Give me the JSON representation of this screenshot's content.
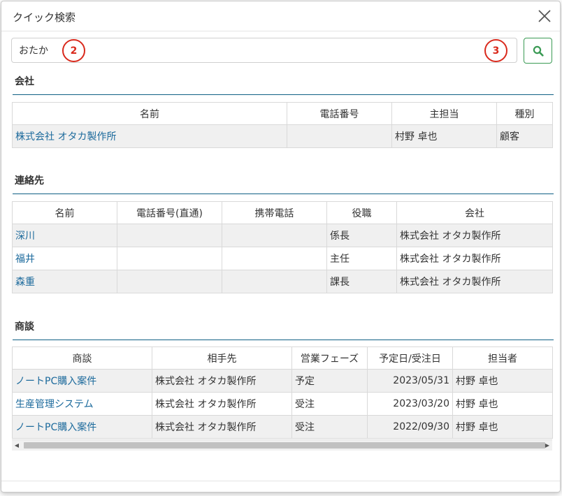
{
  "modal": {
    "title": "クイック検索"
  },
  "search": {
    "value": "おたか",
    "placeholder": "",
    "button_icon": "search-icon",
    "accent": "#3a9a54"
  },
  "markers": [
    "2",
    "3"
  ],
  "sections": {
    "company": {
      "title": "会社",
      "headers": [
        "名前",
        "電話番号",
        "主担当",
        "種別"
      ],
      "rows": [
        [
          "株式会社 オタカ製作所",
          "",
          "村野 卓也",
          "顧客"
        ]
      ]
    },
    "contacts": {
      "title": "連絡先",
      "headers": [
        "名前",
        "電話番号(直通)",
        "携帯電話",
        "役職",
        "会社"
      ],
      "rows": [
        [
          "深川",
          "",
          "",
          "係長",
          "株式会社 オタカ製作所"
        ],
        [
          "福井",
          "",
          "",
          "主任",
          "株式会社 オタカ製作所"
        ],
        [
          "森重",
          "",
          "",
          "課長",
          "株式会社 オタカ製作所"
        ]
      ]
    },
    "deals": {
      "title": "商談",
      "headers": [
        "商談",
        "相手先",
        "営業フェーズ",
        "予定日/受注日",
        "担当者"
      ],
      "rows": [
        [
          "ノートPC購入案件",
          "株式会社 オタカ製作所",
          "予定",
          "2023/05/31",
          "村野 卓也"
        ],
        [
          "生産管理システム",
          "株式会社 オタカ製作所",
          "受注",
          "2023/03/20",
          "村野 卓也"
        ],
        [
          "ノートPC購入案件",
          "株式会社 オタカ製作所",
          "受注",
          "2022/09/30",
          "村野 卓也"
        ]
      ]
    }
  },
  "colors": {
    "link": "#1c6a9c",
    "section_rule": "#0f5f84",
    "marker": "#d9291c",
    "row_alt": "#f0f0f0"
  }
}
